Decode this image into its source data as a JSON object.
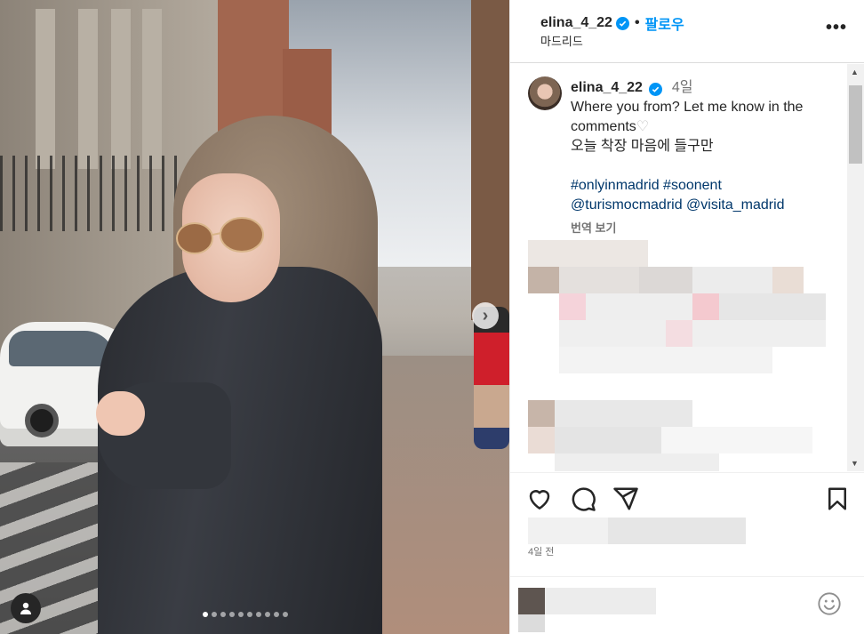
{
  "post": {
    "username": "elina_4_22",
    "follow_label": "팔로우",
    "separator": "•",
    "location": "마드리드",
    "more_label": "•••"
  },
  "caption": {
    "username": "elina_4_22",
    "time_ago": "4일",
    "line1": "Where you from? Let me know in the comments",
    "heart": "♡",
    "line2": "오늘 착장 마음에 들구만",
    "hashtags": "#onlyinmadrid #soonent",
    "mentions": "@turismocmadrid @visita_madrid",
    "translate_label": "번역 보기"
  },
  "carousel": {
    "total": 10,
    "active_index": 0,
    "next_label": "›"
  },
  "footer": {
    "posted_ago": "4일 전"
  },
  "icons": {
    "verified": "verified-badge-icon",
    "like": "heart-icon",
    "comment": "comment-icon",
    "share": "share-icon",
    "save": "bookmark-icon",
    "emoji": "emoji-icon",
    "tag": "user-tag-icon"
  },
  "colors": {
    "accent": "#0095f6",
    "hashtag": "#00376b",
    "muted": "#737373"
  }
}
